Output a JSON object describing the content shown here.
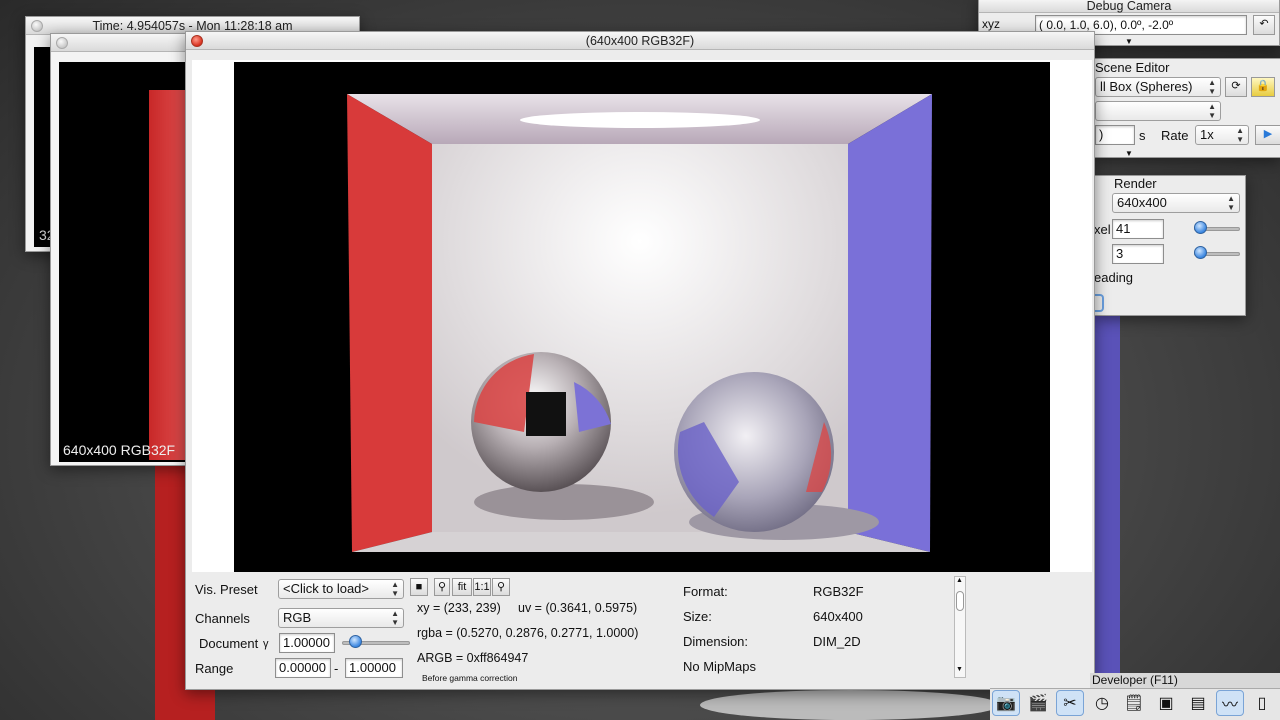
{
  "windows": {
    "time_window": {
      "title": "Time: 4.954057s - Mon 11:28:18 am",
      "partial_label": "32"
    },
    "back_window": {
      "caption": "640x400 RGB32F"
    },
    "main": {
      "title": "(640x400 RGB32F)"
    }
  },
  "viewer": {
    "vis_preset": {
      "label": "Vis. Preset",
      "value": "<Click to load>"
    },
    "channels": {
      "label": "Channels",
      "value": "RGB"
    },
    "document": {
      "label": "Document",
      "gamma_symbol": "γ",
      "gamma_value": "1.00000"
    },
    "range": {
      "label": "Range",
      "min": "0.00000",
      "sep": "-",
      "max": "1.00000"
    },
    "toolbar": {
      "save_icon": "floppy-icon",
      "tool_icon": "wrench-icon",
      "fit": "fit",
      "one_to_one": "1:1",
      "pin_icon": "pin-icon"
    },
    "pixel_info": {
      "xy": "xy =  (233, 239)",
      "uv": "uv =  (0.3641, 0.5975)",
      "rgba": "rgba =  (0.5270, 0.2876, 0.2771, 1.0000)",
      "argb": "ARGB =   0xff864947",
      "note": "Before gamma correction"
    },
    "meta": {
      "format_label": "Format:",
      "format_value": "RGB32F",
      "size_label": "Size:",
      "size_value": "640x400",
      "dimension_label": "Dimension:",
      "dimension_value": "DIM_2D",
      "mipmaps": "No MipMaps"
    }
  },
  "debug_camera": {
    "title": "Debug Camera",
    "xyz_label": "xyz",
    "position_value": " (  0.0,   1.0,   6.0),   0.0º,  -2.0º"
  },
  "scene_editor": {
    "title": "Scene Editor",
    "scene_value": "ll Box (Spheres)",
    "seconds_unit": "s",
    "rate_label": "Rate",
    "rate_value": "1x",
    "partial_field": ")"
  },
  "render": {
    "title": "Render",
    "resolution": "640x400",
    "pixel_label": "xel",
    "pixel_value": "41",
    "second_value": "3",
    "shading_label": "eading"
  },
  "dock": {
    "developer_label": "Developer (F11)",
    "icons": [
      "camera-icon",
      "film-icon",
      "tools-icon",
      "clock-icon",
      "note-icon",
      "terminal-icon",
      "window-icon",
      "graph-icon",
      "doc-icon"
    ]
  }
}
